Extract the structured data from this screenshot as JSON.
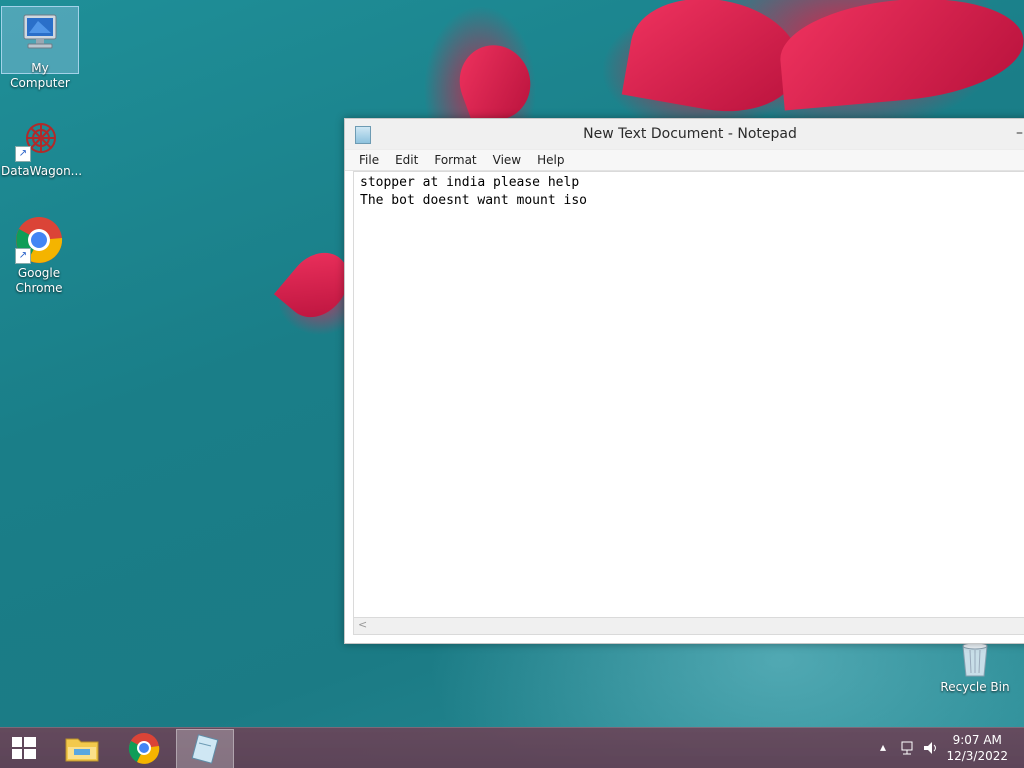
{
  "desktop": {
    "icons": [
      {
        "label": "My Computer"
      },
      {
        "label": "DataWagon..."
      },
      {
        "label": "Google Chrome"
      },
      {
        "label": "Recycle Bin"
      }
    ]
  },
  "notepad": {
    "title": "New Text Document - Notepad",
    "menu": [
      "File",
      "Edit",
      "Format",
      "View",
      "Help"
    ],
    "content": "stopper at india please help\nThe bot doesnt want mount iso",
    "minimize_glyph": "–",
    "scroll_left_glyph": "<"
  },
  "taskbar": {
    "tray_up_glyph": "▴",
    "time": "9:07 AM",
    "date": "12/3/2022"
  },
  "colors": {
    "chrome_red": "#db4437",
    "chrome_yellow": "#f4b400",
    "chrome_green": "#0f9d58",
    "chrome_blue": "#4285f4"
  }
}
